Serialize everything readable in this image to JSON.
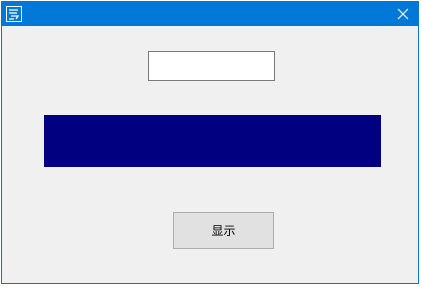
{
  "window": {
    "title": "",
    "app_icon": "app-logo-icon",
    "close_icon": "close-icon"
  },
  "textbox": {
    "value": "",
    "placeholder": ""
  },
  "panel": {
    "color": "#000080"
  },
  "buttons": {
    "show_label": "显示"
  },
  "colors": {
    "titlebar": "#0078d7",
    "window_bg": "#f0f0f0",
    "panel": "#000080",
    "button_bg": "#e1e1e1"
  }
}
